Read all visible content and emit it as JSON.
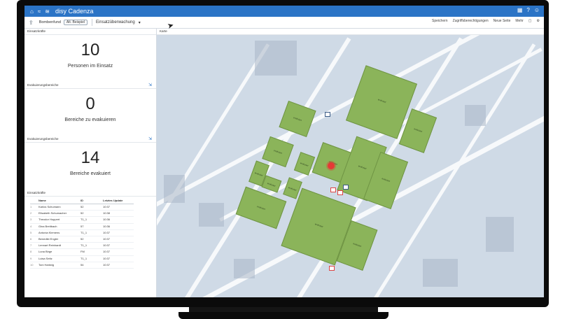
{
  "app": {
    "title": "disy Cadenza",
    "title_icons": [
      "home-icon",
      "wave-icon",
      "layers-icon"
    ],
    "title_right_icons": [
      "grid-icon",
      "help-icon",
      "user-icon"
    ]
  },
  "toolbar": {
    "breadcrumb": "Bombenfund",
    "tag": "Alt. Beispiel",
    "view_name": "Einsatzüberwachung",
    "actions": [
      "Speichern",
      "Zugriffsberechtigungen",
      "Neue Seite",
      "Mehr"
    ]
  },
  "kpis": [
    {
      "section": "Einsatzkräfte",
      "value": "10",
      "label": "Personen im Einsatz"
    },
    {
      "section": "Evakuierungsbereiche",
      "value": "0",
      "label": "Bereiche zu evakuieren"
    },
    {
      "section": "Evakuierungsbereiche",
      "value": "14",
      "label": "Bereiche evakuiert"
    }
  ],
  "table": {
    "section": "Einsatzkräfte",
    "headers": [
      "Name",
      "ID",
      "Letztes Update"
    ],
    "rows": [
      {
        "idx": "1",
        "name": "Karlos Schumann",
        "id": "52",
        "update": "10:37"
      },
      {
        "idx": "2",
        "name": "Elisabeth Schumacher",
        "id": "52",
        "update": "10:38"
      },
      {
        "idx": "3",
        "name": "Theodor Hoppert",
        "id": "T1_1",
        "update": "10:36"
      },
      {
        "idx": "4",
        "name": "Gina Breitbach",
        "id": "57",
        "update": "10:36"
      },
      {
        "idx": "5",
        "name": "Antonia Klemens",
        "id": "T1_1",
        "update": "10:37"
      },
      {
        "idx": "6",
        "name": "Benedikt Engler",
        "id": "52",
        "update": "10:37"
      },
      {
        "idx": "7",
        "name": "Lennart Reinhardt",
        "id": "T1_1",
        "update": "10:37"
      },
      {
        "idx": "8",
        "name": "Luna Birge",
        "id": "FM",
        "update": "10:37"
      },
      {
        "idx": "9",
        "name": "Luisa Seitz",
        "id": "T1_1",
        "update": "10:37"
      },
      {
        "idx": "10",
        "name": "Toni Hartwig",
        "id": "54",
        "update": "10:37"
      }
    ]
  },
  "map": {
    "title": "Karte",
    "zone_label": "evakuiert",
    "zone_color": "#8bb45a",
    "marker_color": "#e53935"
  },
  "colors": {
    "accent": "#2b74c6"
  }
}
